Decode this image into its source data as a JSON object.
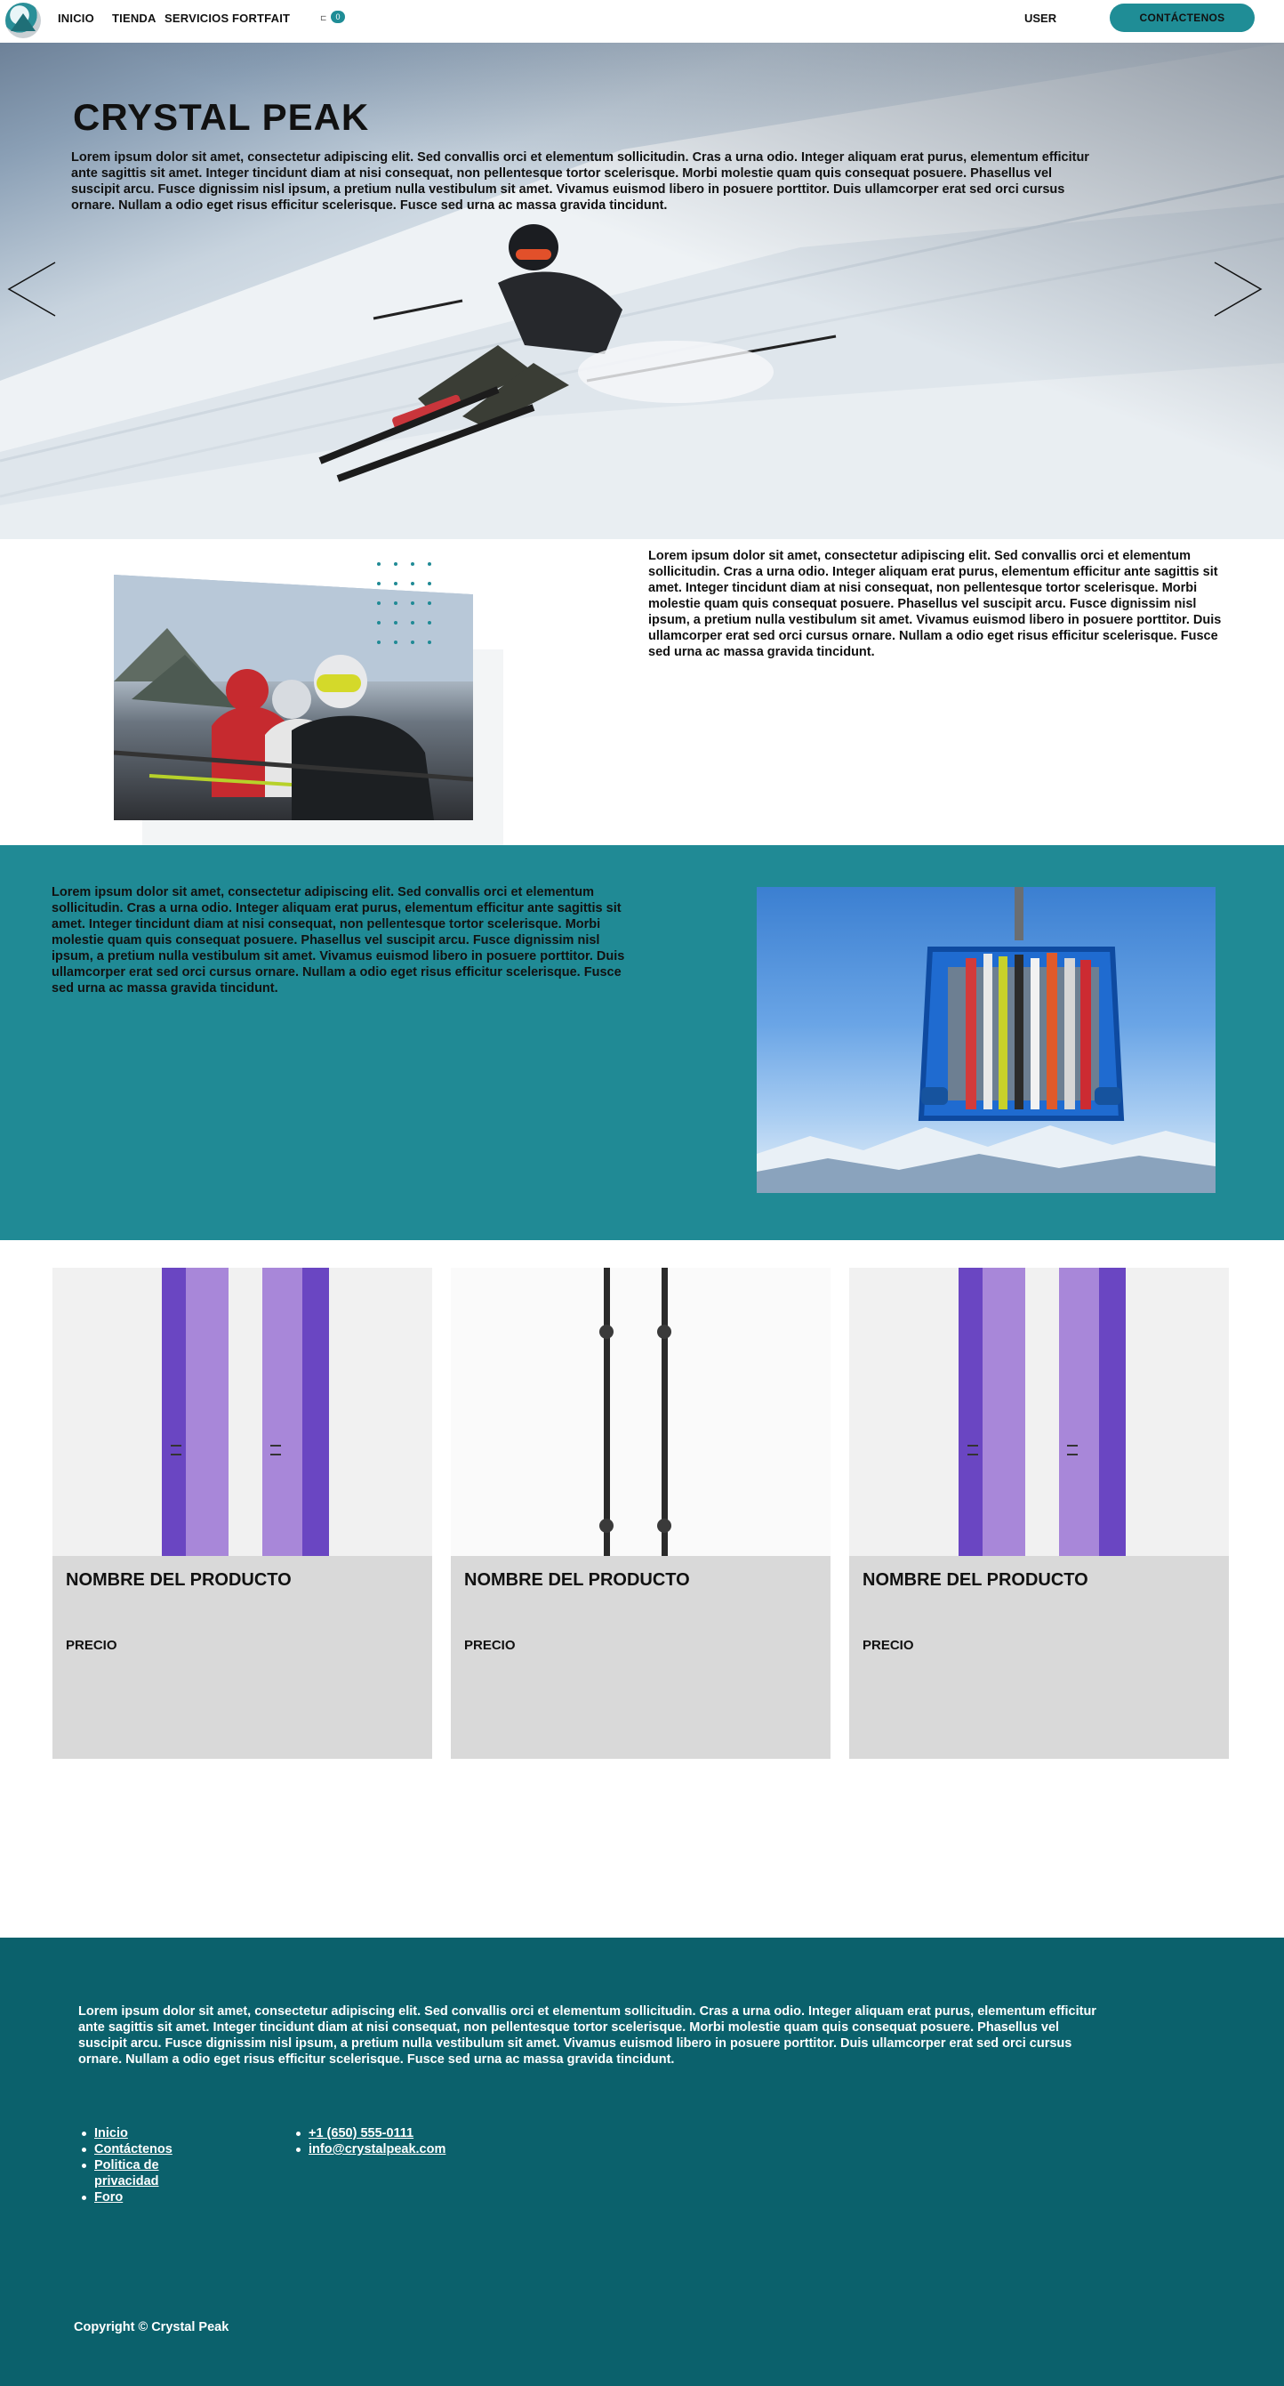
{
  "nav": {
    "links": [
      "INICIO",
      "TIENDA",
      "SERVICIOS",
      "FORTFAIT"
    ],
    "cart_count": "0",
    "user_label": "USER",
    "contact_label": "CONTÁCTENOS"
  },
  "hero": {
    "title": "CRYSTAL PEAK",
    "text": "Lorem ipsum dolor sit amet, consectetur adipiscing elit. Sed convallis orci et elementum sollicitudin. Cras a urna odio. Integer aliquam erat purus, elementum efficitur ante sagittis sit amet. Integer tincidunt diam at nisi consequat, non pellentesque tortor scelerisque. Morbi molestie quam quis consequat posuere. Phasellus vel suscipit arcu. Fusce dignissim nisl ipsum, a pretium nulla vestibulum sit amet. Vivamus euismod libero in posuere porttitor. Duis ullamcorper erat sed orci cursus ornare. Nullam a odio eget risus efficitur scelerisque. Fusce sed urna ac massa gravida tincidunt."
  },
  "section2": {
    "text": "Lorem ipsum dolor sit amet, consectetur adipiscing elit. Sed convallis orci et elementum sollicitudin. Cras a urna odio. Integer aliquam erat purus, elementum efficitur ante sagittis sit amet. Integer tincidunt diam at nisi consequat, non pellentesque tortor scelerisque. Morbi molestie quam quis consequat posuere. Phasellus vel suscipit arcu. Fusce dignissim nisl ipsum, a pretium nulla vestibulum sit amet. Vivamus euismod libero in posuere porttitor. Duis ullamcorper erat sed orci cursus ornare. Nullam a odio eget risus efficitur scelerisque. Fusce sed urna ac massa gravida tincidunt."
  },
  "section3": {
    "text": "Lorem ipsum dolor sit amet, consectetur adipiscing elit. Sed convallis orci et elementum sollicitudin. Cras a urna odio. Integer aliquam erat purus, elementum efficitur ante sagittis sit amet. Integer tincidunt diam at nisi consequat, non pellentesque tortor scelerisque. Morbi molestie quam quis consequat posuere. Phasellus vel suscipit arcu. Fusce dignissim nisl ipsum, a pretium nulla vestibulum sit amet. Vivamus euismod libero in posuere porttitor. Duis ullamcorper erat sed orci cursus ornare. Nullam a odio eget risus efficitur scelerisque. Fusce sed urna ac massa gravida tincidunt."
  },
  "products": [
    {
      "name": "NOMBRE DEL PRODUCTO",
      "price": "PRECIO"
    },
    {
      "name": "NOMBRE DEL PRODUCTO",
      "price": "PRECIO"
    },
    {
      "name": "NOMBRE DEL PRODUCTO",
      "price": "PRECIO"
    }
  ],
  "footer": {
    "text": "Lorem ipsum dolor sit amet, consectetur adipiscing elit. Sed convallis orci et elementum sollicitudin. Cras a urna odio. Integer aliquam erat purus, elementum efficitur ante sagittis sit amet. Integer tincidunt diam at nisi consequat, non pellentesque tortor scelerisque. Morbi molestie quam quis consequat posuere. Phasellus vel suscipit arcu. Fusce dignissim nisl ipsum, a pretium nulla vestibulum sit amet. Vivamus euismod libero in posuere porttitor. Duis ullamcorper erat sed orci cursus ornare. Nullam a odio eget risus efficitur scelerisque. Fusce sed urna ac massa gravida tincidunt.",
    "links": [
      "Inicio",
      "Contáctenos",
      "Politica de privacidad",
      "Foro"
    ],
    "contacts": [
      "+1 (650) 555-0111",
      "info@crystalpeak.com"
    ],
    "copyright": "Copyright © Crystal Peak"
  },
  "colors": {
    "accent": "#208a95",
    "footer_bg": "#0b616c",
    "card_bg": "#d9d9d9"
  },
  "icons": {
    "logo": "mountain-logo-icon",
    "cart": "cart-icon",
    "prev": "chevron-left-icon",
    "next": "chevron-right-icon"
  }
}
